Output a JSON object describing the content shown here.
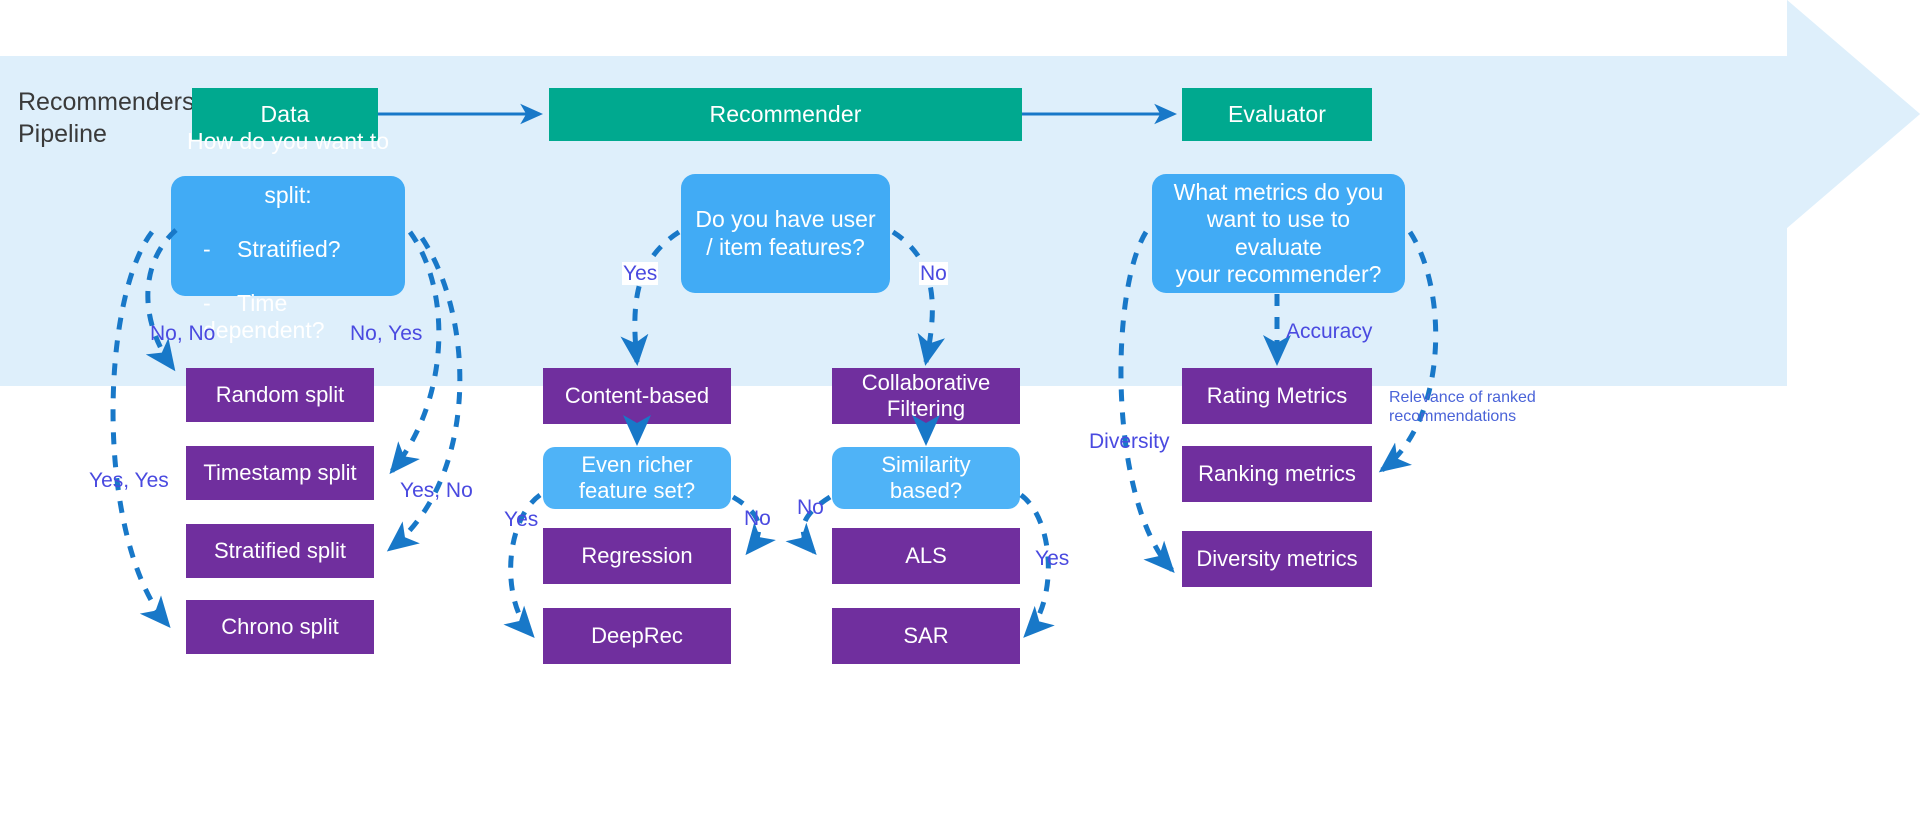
{
  "colors": {
    "banner_fill": "#DEEFFB",
    "stage_green": "#00A98F",
    "decision_blue": "#41ABF5",
    "decision_blue_light": "#4FB3F7",
    "algo_purple": "#702F9E",
    "arrow_blue": "#1878C8",
    "label_indigo": "#4A4AE0",
    "title_gray": "#3A3A3A"
  },
  "pipeline": {
    "title": "Recommenders\nPipeline",
    "stages": [
      {
        "id": "data",
        "label": "Data"
      },
      {
        "id": "recommender",
        "label": "Recommender"
      },
      {
        "id": "evaluator",
        "label": "Evaluator"
      }
    ]
  },
  "decisions": [
    {
      "id": "split",
      "label": "How do you want to\nsplit:\n-    Stratified?\n-    Time dependent?"
    },
    {
      "id": "features",
      "label": "Do you have user\n/ item features?"
    },
    {
      "id": "metrics",
      "label": "What metrics do you\nwant to use to evaluate\nyour recommender?"
    },
    {
      "id": "richer",
      "label": "Even richer\nfeature set?"
    },
    {
      "id": "similarity",
      "label": "Similarity\nbased?"
    }
  ],
  "split_decision_lines": {
    "line1": "How do you want to",
    "line2": "split:",
    "item1_dash": "-",
    "item1": "Stratified?",
    "item2_dash": "-",
    "item2": "Time dependent?"
  },
  "algorithms": {
    "split_methods": [
      {
        "id": "random-split",
        "label": "Random split"
      },
      {
        "id": "timestamp-split",
        "label": "Timestamp split"
      },
      {
        "id": "stratified-split",
        "label": "Stratified split"
      },
      {
        "id": "chrono-split",
        "label": "Chrono split"
      }
    ],
    "content_branch": [
      {
        "id": "content-based",
        "label": "Content-based"
      },
      {
        "id": "regression",
        "label": "Regression"
      },
      {
        "id": "deeprec",
        "label": "DeepRec"
      }
    ],
    "collaborative_branch": [
      {
        "id": "collaborative-filtering",
        "label": "Collaborative\nFiltering"
      },
      {
        "id": "als",
        "label": "ALS"
      },
      {
        "id": "sar",
        "label": "SAR"
      }
    ],
    "metrics": [
      {
        "id": "rating-metrics",
        "label": "Rating Metrics"
      },
      {
        "id": "ranking-metrics",
        "label": "Ranking metrics"
      },
      {
        "id": "diversity-metrics",
        "label": "Diversity metrics"
      }
    ]
  },
  "edge_labels": [
    {
      "id": "no-no",
      "text": "No, No"
    },
    {
      "id": "no-yes",
      "text": "No, Yes"
    },
    {
      "id": "yes-yes",
      "text": "Yes, Yes"
    },
    {
      "id": "yes-no",
      "text": "Yes, No"
    },
    {
      "id": "features-yes",
      "text": "Yes"
    },
    {
      "id": "features-no",
      "text": "No"
    },
    {
      "id": "richer-yes",
      "text": "Yes"
    },
    {
      "id": "richer-no",
      "text": "No"
    },
    {
      "id": "similarity-no",
      "text": "No"
    },
    {
      "id": "similarity-yes",
      "text": "Yes"
    },
    {
      "id": "accuracy",
      "text": "Accuracy"
    },
    {
      "id": "diversity",
      "text": "Diversity"
    },
    {
      "id": "relevance",
      "text": "Relevance of ranked\nrecommendations"
    }
  ]
}
